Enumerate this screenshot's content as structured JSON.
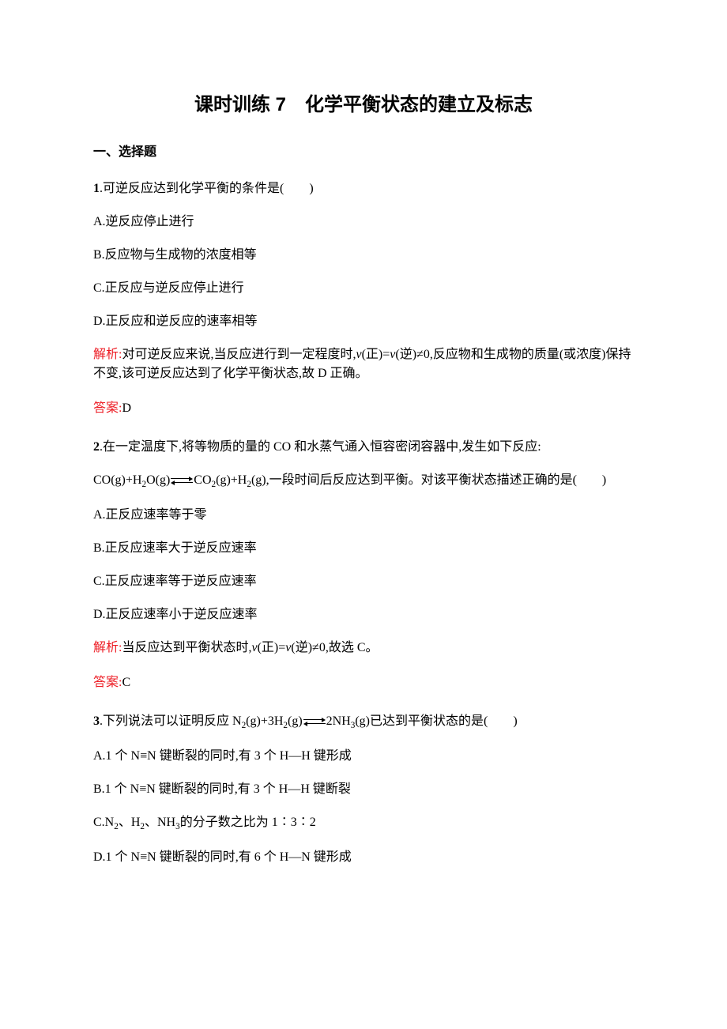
{
  "title": "课时训练 7　化学平衡状态的建立及标志",
  "section_header": "一、选择题",
  "q1": {
    "num": "1",
    "text": ".可逆反应达到化学平衡的条件是(　　)",
    "optA": "A.逆反应停止进行",
    "optB": "B.反应物与生成物的浓度相等",
    "optC": "C.正反应与逆反应停止进行",
    "optD": "D.正反应和逆反应的速率相等",
    "explain_label": "解析:",
    "explain_a": "对可逆反应来说,当反应进行到一定程度时,",
    "explain_b": "(正)=",
    "explain_c": "(逆)≠0,反应物和生成物的质量(或浓度)保持不变,该可逆反应达到了化学平衡状态,故 D 正确。",
    "answer_label": "答案:",
    "answer": "D"
  },
  "q2": {
    "num": "2",
    "text": ".在一定温度下,将等物质的量的 CO 和水蒸气通入恒容密闭容器中,发生如下反应:",
    "eq_left": "CO(g)+H",
    "eq_mid1": "O(g)",
    "eq_mid2": "CO",
    "eq_mid3": "(g)+H",
    "eq_right": "(g),一段时间后反应达到平衡。对该平衡状态描述正确的是(　　)",
    "optA": "A.正反应速率等于零",
    "optB": "B.正反应速率大于逆反应速率",
    "optC": "C.正反应速率等于逆反应速率",
    "optD": "D.正反应速率小于逆反应速率",
    "explain_label": "解析:",
    "explain_a": "当反应达到平衡状态时,",
    "explain_b": "(正)=",
    "explain_c": "(逆)≠0,故选 C。",
    "answer_label": "答案:",
    "answer": "C"
  },
  "q3": {
    "num": "3",
    "text_a": ".下列说法可以证明反应 N",
    "text_b": "(g)+3H",
    "text_c": "(g)",
    "text_d": "2NH",
    "text_e": "(g)已达到平衡状态的是(　　)",
    "optA": "A.1 个 N≡N 键断裂的同时,有 3 个 H—H 键形成",
    "optB": "B.1 个 N≡N 键断裂的同时,有 3 个 H—H 键断裂",
    "optC_a": "C.N",
    "optC_b": "、H",
    "optC_c": "、NH",
    "optC_d": "的分子数之比为 1∶3∶2",
    "optD": "D.1 个 N≡N 键断裂的同时,有 6 个 H—N 键形成"
  }
}
